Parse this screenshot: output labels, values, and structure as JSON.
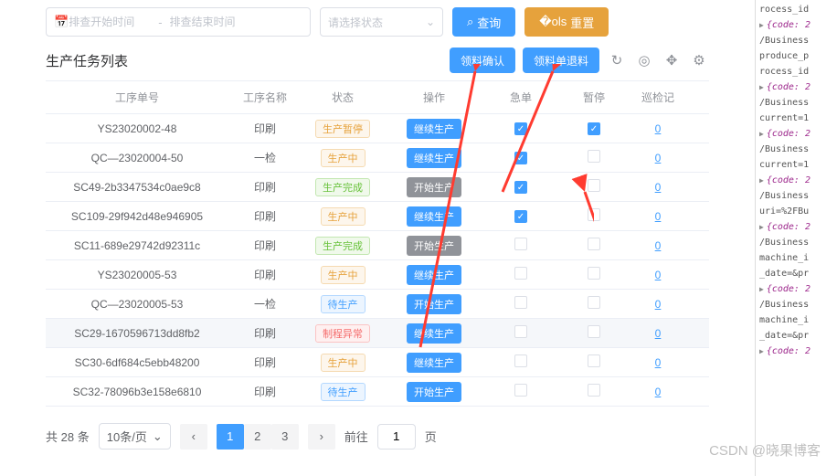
{
  "filters": {
    "start_placeholder": "排查开始时间",
    "end_placeholder": "排查结束时间",
    "separator": "-",
    "status_placeholder": "请选择状态",
    "query_label": "查询",
    "reset_label": "重置"
  },
  "header": {
    "title": "生产任务列表",
    "confirm_label": "领料确认",
    "return_label": "领料单退料"
  },
  "columns": {
    "order": "工序单号",
    "name": "工序名称",
    "status": "状态",
    "action": "操作",
    "urgent": "急单",
    "pause": "暂停",
    "inspect": "巡检记"
  },
  "rows": [
    {
      "order": "YS23020002-48",
      "name": "印刷",
      "status": "生产暂停",
      "status_cls": "tag-orange",
      "action": "继续生产",
      "action_cls": "ab-blue",
      "urgent": true,
      "pause": true,
      "inspect": "0"
    },
    {
      "order": "QC—23020004-50",
      "name": "一检",
      "status": "生产中",
      "status_cls": "tag-orange",
      "action": "继续生产",
      "action_cls": "ab-blue",
      "urgent": true,
      "pause": false,
      "inspect": "0"
    },
    {
      "order": "SC49-2b3347534c0ae9c8",
      "name": "印刷",
      "status": "生产完成",
      "status_cls": "tag-green",
      "action": "开始生产",
      "action_cls": "ab-gray",
      "urgent": true,
      "pause": false,
      "inspect": "0"
    },
    {
      "order": "SC109-29f942d48e946905",
      "name": "印刷",
      "status": "生产中",
      "status_cls": "tag-orange",
      "action": "继续生产",
      "action_cls": "ab-blue",
      "urgent": true,
      "pause": false,
      "inspect": "0"
    },
    {
      "order": "SC11-689e29742d92311c",
      "name": "印刷",
      "status": "生产完成",
      "status_cls": "tag-green",
      "action": "开始生产",
      "action_cls": "ab-gray",
      "urgent": false,
      "pause": false,
      "inspect": "0"
    },
    {
      "order": "YS23020005-53",
      "name": "印刷",
      "status": "生产中",
      "status_cls": "tag-orange",
      "action": "继续生产",
      "action_cls": "ab-blue",
      "urgent": false,
      "pause": false,
      "inspect": "0"
    },
    {
      "order": "QC—23020005-53",
      "name": "一检",
      "status": "待生产",
      "status_cls": "tag-blue",
      "action": "开始生产",
      "action_cls": "ab-blue",
      "urgent": false,
      "pause": false,
      "inspect": "0"
    },
    {
      "order": "SC29-1670596713dd8fb2",
      "name": "印刷",
      "status": "制程异常",
      "status_cls": "tag-red",
      "action": "继续生产",
      "action_cls": "ab-blue",
      "urgent": false,
      "pause": false,
      "inspect": "0",
      "highlight": true
    },
    {
      "order": "SC30-6df684c5ebb48200",
      "name": "印刷",
      "status": "生产中",
      "status_cls": "tag-orange",
      "action": "继续生产",
      "action_cls": "ab-blue",
      "urgent": false,
      "pause": false,
      "inspect": "0"
    },
    {
      "order": "SC32-78096b3e158e6810",
      "name": "印刷",
      "status": "待生产",
      "status_cls": "tag-blue",
      "action": "开始生产",
      "action_cls": "ab-blue",
      "urgent": false,
      "pause": false,
      "inspect": "0"
    }
  ],
  "pagination": {
    "total_prefix": "共",
    "total_count": "28",
    "total_suffix": "条",
    "page_size": "10条/页",
    "pages": [
      "1",
      "2",
      "3"
    ],
    "active_page": "1",
    "goto_prefix": "前往",
    "goto_value": "1",
    "goto_suffix": "页"
  },
  "devtools": {
    "lines": [
      {
        "text": "rocess_id"
      },
      {
        "tri": true,
        "code": "{code: 2"
      },
      {
        "text": "/Business"
      },
      {
        "text": "produce_p"
      },
      {
        "text": "rocess_id"
      },
      {
        "tri": true,
        "code": "{code: 2"
      },
      {
        "text": "/Business"
      },
      {
        "text": "current=1"
      },
      {
        "tri": true,
        "code": "{code: 2"
      },
      {
        "text": "/Business"
      },
      {
        "text": "current=1"
      },
      {
        "tri": true,
        "code": "{code: 2"
      },
      {
        "text": "/Business"
      },
      {
        "text": "uri=%2FBu"
      },
      {
        "tri": true,
        "code": "{code: 2"
      },
      {
        "text": "/Business"
      },
      {
        "text": "machine_i"
      },
      {
        "text": "_date=&pr"
      },
      {
        "tri": true,
        "code": "{code: 2"
      },
      {
        "text": "/Business"
      },
      {
        "text": "machine_i"
      },
      {
        "text": "_date=&pr"
      },
      {
        "tri": true,
        "code": "{code: 2"
      }
    ]
  },
  "watermark": "CSDN @晓果博客"
}
